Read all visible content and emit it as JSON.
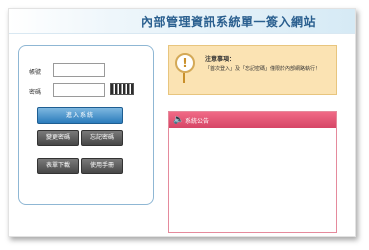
{
  "header": {
    "title": "內部管理資訊系統單一簽入網站"
  },
  "login": {
    "account_label": "帳號",
    "password_label": "密碼",
    "account_value": "",
    "password_value": "",
    "captcha_icon": "captcha-image",
    "login_button": "進入系統",
    "change_password_button": "變更密碼",
    "forgot_password_button": "忘記密碼",
    "form_download_button": "表單下載",
    "user_manual_button": "使用手冊"
  },
  "notice": {
    "icon": "info-icon",
    "title": "注意事項：",
    "text": "「首次登入」及「忘記密碼」僅限於內部網路執行！"
  },
  "announcement": {
    "icon": "speaker-icon",
    "title": "系統公告"
  },
  "colors": {
    "title": "#2a5f8f",
    "login_button": "#2b7cbc",
    "notice_background": "#fbe3b3",
    "announcement_header": "#d64566"
  }
}
